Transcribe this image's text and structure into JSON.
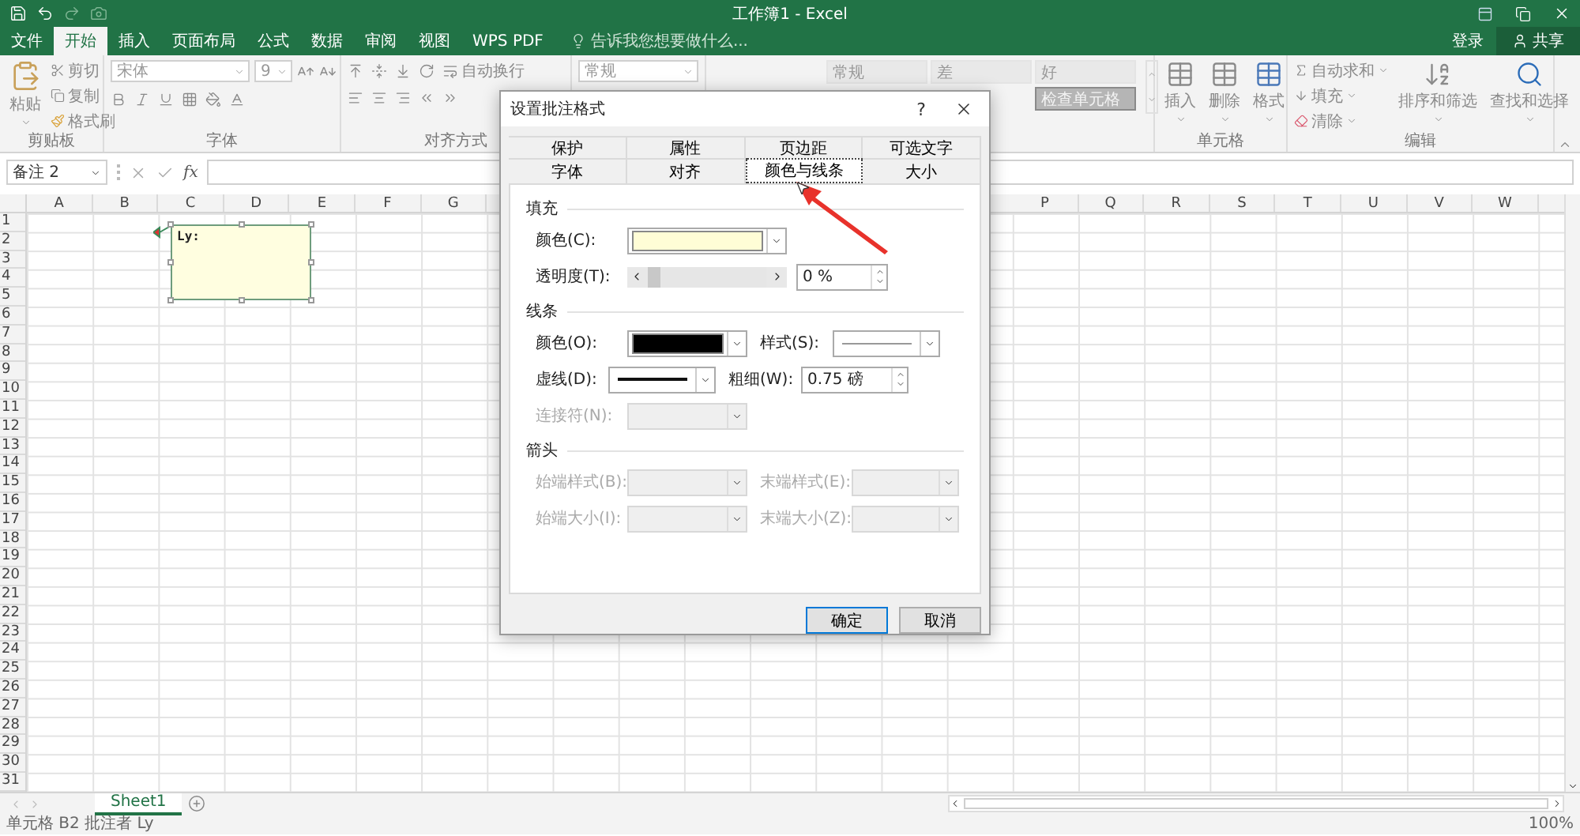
{
  "title_bar": {
    "title": "工作簿1 - Excel"
  },
  "menu_tabs": [
    {
      "label": "文件",
      "selected": false
    },
    {
      "label": "开始",
      "selected": true
    },
    {
      "label": "插入",
      "selected": false
    },
    {
      "label": "页面布局",
      "selected": false
    },
    {
      "label": "公式",
      "selected": false
    },
    {
      "label": "数据",
      "selected": false
    },
    {
      "label": "审阅",
      "selected": false
    },
    {
      "label": "视图",
      "selected": false
    },
    {
      "label": "WPS PDF",
      "selected": false
    }
  ],
  "tell_me": {
    "placeholder": "告诉我您想要做什么..."
  },
  "account": {
    "sign_in": "登录",
    "share": "共享"
  },
  "ribbon": {
    "clipboard": {
      "label": "剪贴板",
      "paste": "粘贴",
      "cut": "剪切",
      "copy": "复制",
      "format_painter": "格式刷"
    },
    "font": {
      "label": "字体",
      "font_name": "宋体",
      "font_size": "9"
    },
    "alignment": {
      "label": "对齐方式",
      "wrap_text": "自动换行"
    },
    "number": {
      "format": "常规"
    },
    "styles": [
      {
        "label": "常规",
        "kind": "plain"
      },
      {
        "label": "差",
        "kind": "plain"
      },
      {
        "label": "好",
        "kind": "plain"
      },
      {
        "label": "检查单元格",
        "kind": "check"
      }
    ],
    "cells": {
      "label": "单元格",
      "insert": "插入",
      "delete": "删除",
      "format": "格式"
    },
    "editing": {
      "label": "编辑",
      "autosum": "自动求和",
      "fill": "填充",
      "clear": "清除",
      "sort_filter": "排序和筛选",
      "find_select": "查找和选择"
    }
  },
  "formula_bar": {
    "name_box": "备注 2",
    "function_label": "fx"
  },
  "sheet": {
    "columns": [
      "A",
      "B",
      "C",
      "D",
      "E",
      "F",
      "G"
    ],
    "columns_right": [
      "P",
      "Q",
      "R",
      "S",
      "T",
      "U",
      "V",
      "W"
    ],
    "rows": [
      "1",
      "2",
      "3",
      "4",
      "5",
      "6",
      "7",
      "8",
      "9",
      "10",
      "11",
      "12",
      "13",
      "14",
      "15",
      "16",
      "17",
      "18",
      "19",
      "20",
      "21",
      "22",
      "23",
      "24",
      "25",
      "26",
      "27",
      "28",
      "29",
      "30",
      "31"
    ]
  },
  "comment": {
    "text": "Ly:"
  },
  "sheet_tabs": [
    {
      "label": "Sheet1",
      "selected": true
    }
  ],
  "status_bar": {
    "text": "单元格 B2 批注者 Ly",
    "zoom": "100%"
  },
  "dialog": {
    "title": "设置批注格式",
    "help": "?",
    "tabs_row_1": [
      {
        "label": "保护",
        "selected": false
      },
      {
        "label": "属性",
        "selected": false
      },
      {
        "label": "页边距",
        "selected": false
      },
      {
        "label": "可选文字",
        "selected": false
      }
    ],
    "tabs_row_2": [
      {
        "label": "字体",
        "selected": false
      },
      {
        "label": "对齐",
        "selected": false
      },
      {
        "label": "颜色与线条",
        "selected": true
      },
      {
        "label": "大小",
        "selected": false
      }
    ],
    "sections": [
      {
        "title": "填充",
        "rows": [
          [
            {
              "kind": "color",
              "label": "颜色(C):",
              "color": "#fffdd6",
              "wide": true,
              "disabled": false
            }
          ],
          [
            {
              "kind": "slider",
              "label": "透明度(T):",
              "level": 0,
              "value": "0 %",
              "disabled": false
            }
          ]
        ]
      },
      {
        "title": "线条",
        "rows": [
          [
            {
              "kind": "color",
              "label": "颜色(O):",
              "color": "#000000",
              "wide": false,
              "disabled": false
            },
            {
              "kind": "line",
              "label": "样式(S):",
              "thick": false,
              "disabled": false
            }
          ],
          [
            {
              "kind": "line",
              "label": "虚线(D):",
              "thick": true,
              "disabled": false
            },
            {
              "kind": "spinner",
              "label": "粗细(W):",
              "value": "0.75 磅",
              "disabled": false
            }
          ],
          [
            {
              "kind": "empty",
              "label": "连接符(N):",
              "disabled": true
            }
          ]
        ]
      },
      {
        "title": "箭头",
        "rows": [
          [
            {
              "kind": "empty",
              "label": "始端样式(B):",
              "disabled": true
            },
            {
              "kind": "empty",
              "label": "末端样式(E):",
              "disabled": true
            }
          ],
          [
            {
              "kind": "empty",
              "label": "始端大小(I):",
              "disabled": true
            },
            {
              "kind": "empty",
              "label": "末端大小(Z):",
              "disabled": true
            }
          ]
        ]
      }
    ],
    "buttons": [
      {
        "label": "确定",
        "default": true
      },
      {
        "label": "取消",
        "default": false
      }
    ]
  }
}
